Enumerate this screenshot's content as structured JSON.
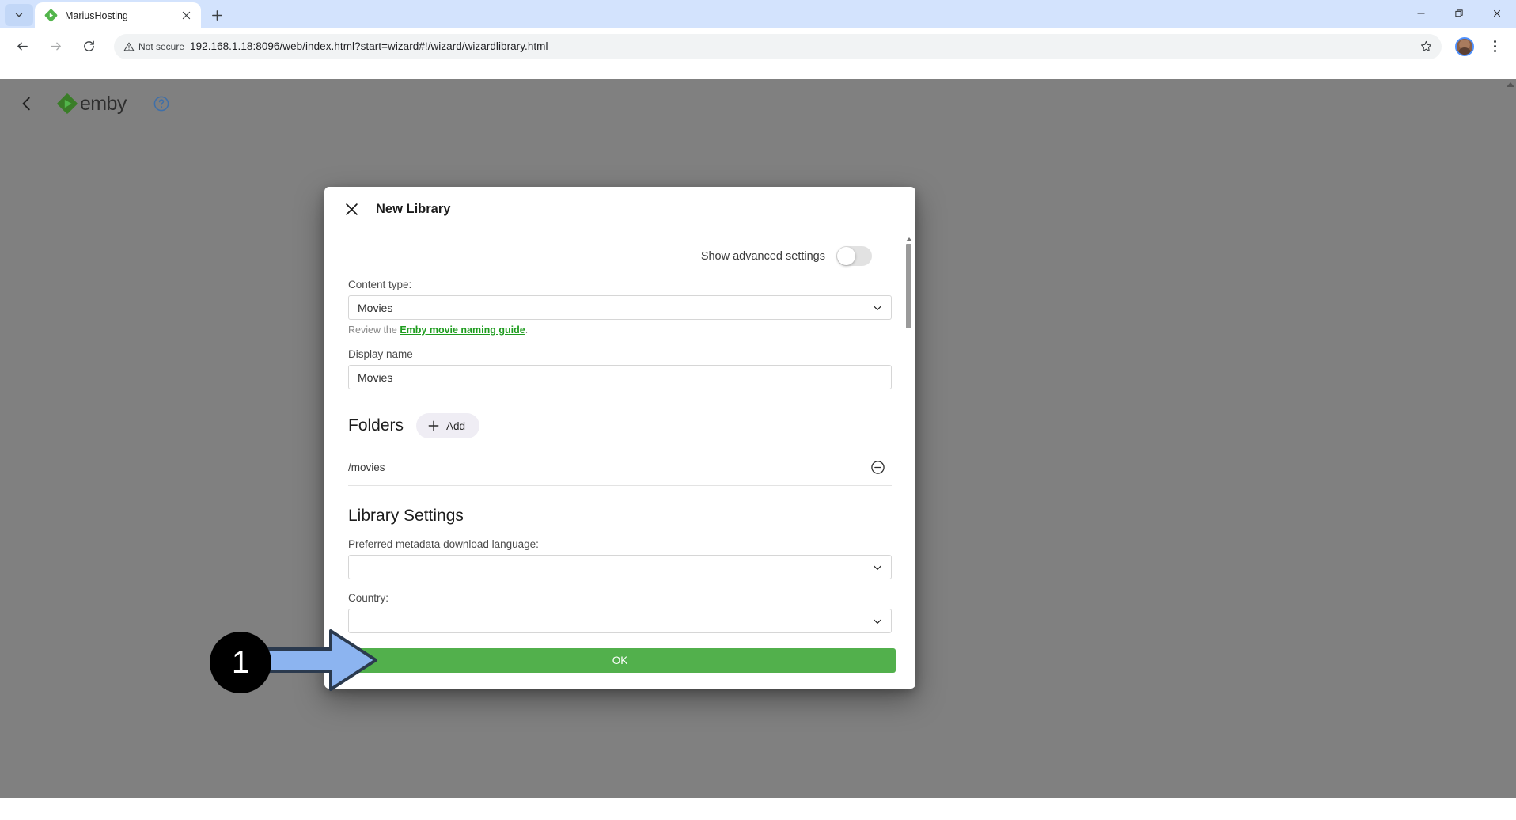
{
  "browser": {
    "tab": {
      "title": "MariusHosting",
      "favicon_icon": "emby-favicon",
      "close_icon": "close-icon"
    },
    "tab_list_icon": "chevron-down-icon",
    "new_tab_icon": "plus-icon",
    "window_controls": {
      "minimize_icon": "minimize-icon",
      "restore_icon": "restore-icon",
      "close_icon": "close-icon"
    },
    "toolbar": {
      "back_icon": "arrow-back-icon",
      "forward_icon": "arrow-forward-icon",
      "reload_icon": "reload-icon",
      "security_label": "Not secure",
      "security_icon": "warning-triangle-icon",
      "url": "192.168.1.18:8096/web/index.html?start=wizard#!/wizard/wizardlibrary.html",
      "bookmark_icon": "star-icon",
      "avatar_icon": "profile-avatar",
      "menu_icon": "three-dot-menu-icon"
    }
  },
  "app_header": {
    "back_icon": "chevron-left-icon",
    "logo_text": "emby",
    "logo_icon": "emby-logo-icon",
    "help_icon": "question-mark-circle-icon"
  },
  "dialog": {
    "title": "New Library",
    "close_icon": "close-icon",
    "advanced": {
      "label": "Show advanced settings",
      "toggle_state": "off"
    },
    "content_type": {
      "label": "Content type:",
      "value": "Movies",
      "caret_icon": "chevron-down-icon"
    },
    "naming_guide": {
      "prefix": "Review the ",
      "link": "Emby movie naming guide",
      "suffix": "."
    },
    "display_name": {
      "label": "Display name",
      "value": "Movies"
    },
    "folders": {
      "title": "Folders",
      "add_label": "Add",
      "add_icon": "plus-icon",
      "items": [
        {
          "path": "/movies",
          "remove_icon": "minus-circle-icon"
        }
      ]
    },
    "library_settings": {
      "title": "Library Settings",
      "metadata_language": {
        "label": "Preferred metadata download language:",
        "value": "",
        "caret_icon": "chevron-down-icon"
      },
      "country": {
        "label": "Country:",
        "value": "",
        "caret_icon": "chevron-down-icon"
      }
    },
    "ok_label": "OK"
  },
  "annotation": {
    "step_number": "1",
    "arrow_icon": "right-arrow-callout"
  },
  "colors": {
    "accent_green": "#52b04c",
    "link_green": "#1e9c1e",
    "page_gray": "#808080",
    "tabstrip_blue": "#d3e3fd",
    "arrow_blue": "#8cb4f0",
    "arrow_outline": "#2b3a4e"
  }
}
